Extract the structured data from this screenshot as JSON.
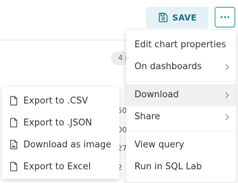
{
  "header": {
    "save_label": "SAVE"
  },
  "badge": {
    "text": "4 r"
  },
  "table_fragments": [
    "50",
    "00",
    "27",
    "2"
  ],
  "menu": {
    "items": [
      {
        "label": "Edit chart properties",
        "has_submenu": false
      },
      {
        "label": "On dashboards",
        "has_submenu": true
      },
      {
        "label": "Download",
        "has_submenu": true,
        "active": true
      },
      {
        "label": "Share",
        "has_submenu": true
      },
      {
        "label": "View query",
        "has_submenu": false
      },
      {
        "label": "Run in SQL Lab",
        "has_submenu": false
      }
    ]
  },
  "submenu": {
    "items": [
      {
        "label": "Export to .CSV",
        "icon": "file-icon"
      },
      {
        "label": "Export to .JSON",
        "icon": "file-icon"
      },
      {
        "label": "Download as image",
        "icon": "file-image-icon"
      },
      {
        "label": "Export to Excel",
        "icon": "file-icon"
      }
    ]
  },
  "colors": {
    "accent": "#1f8aa3",
    "save_bg": "#e4f2f6",
    "menu_active_bg": "#f0f0f0",
    "text": "#333333"
  }
}
